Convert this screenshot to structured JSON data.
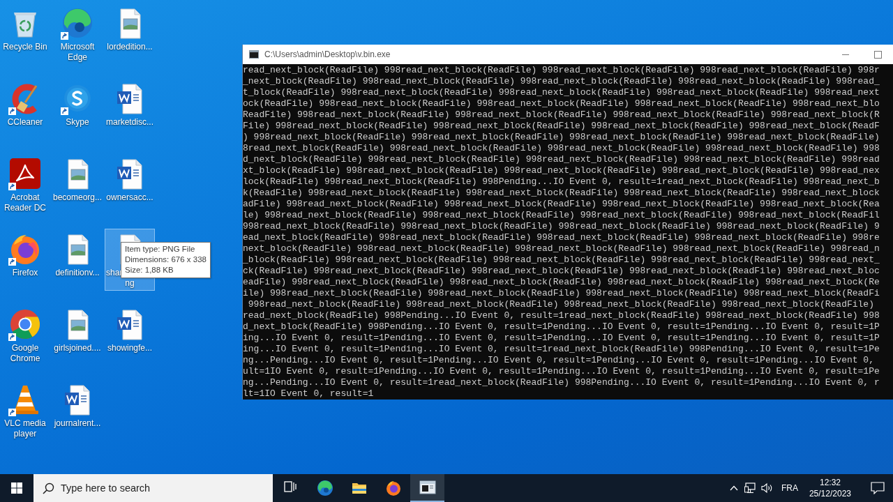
{
  "desktop_icons": [
    {
      "lines": [
        "Recycle Bin"
      ],
      "kind": "recycle",
      "shortcut": false,
      "selected": false
    },
    {
      "lines": [
        "Microsoft",
        "Edge"
      ],
      "kind": "edge",
      "shortcut": true,
      "selected": false
    },
    {
      "lines": [
        "lordedition..."
      ],
      "kind": "image",
      "shortcut": false,
      "selected": false
    },
    {
      "lines": [
        "CCleaner"
      ],
      "kind": "ccleaner",
      "shortcut": true,
      "selected": false
    },
    {
      "lines": [
        "Skype"
      ],
      "kind": "skype",
      "shortcut": true,
      "selected": false
    },
    {
      "lines": [
        "marketdisc..."
      ],
      "kind": "word",
      "shortcut": false,
      "selected": false
    },
    {
      "lines": [
        "Acrobat",
        "Reader DC"
      ],
      "kind": "acrobat",
      "shortcut": true,
      "selected": false
    },
    {
      "lines": [
        "becomeorg..."
      ],
      "kind": "image",
      "shortcut": false,
      "selected": false
    },
    {
      "lines": [
        "ownersacc..."
      ],
      "kind": "word",
      "shortcut": false,
      "selected": false
    },
    {
      "lines": [
        "Firefox"
      ],
      "kind": "firefox",
      "shortcut": true,
      "selected": false
    },
    {
      "lines": [
        "definitionv..."
      ],
      "kind": "image",
      "shortcut": false,
      "selected": false
    },
    {
      "lines": [
        "shar",
        "ng"
      ],
      "kind": "image",
      "shortcut": false,
      "selected": true
    },
    {
      "lines": [
        "Google",
        "Chrome"
      ],
      "kind": "chrome",
      "shortcut": true,
      "selected": false
    },
    {
      "lines": [
        "girlsjoined...."
      ],
      "kind": "image",
      "shortcut": false,
      "selected": false
    },
    {
      "lines": [
        "showingfe..."
      ],
      "kind": "word",
      "shortcut": false,
      "selected": false
    },
    {
      "lines": [
        "VLC media",
        "player"
      ],
      "kind": "vlc",
      "shortcut": true,
      "selected": false
    },
    {
      "lines": [
        "journalrent..."
      ],
      "kind": "word",
      "shortcut": false,
      "selected": false
    }
  ],
  "tooltip": {
    "lines": [
      "Item type: PNG File",
      "Dimensions: 676 x 338",
      "Size: 1,88 KB"
    ]
  },
  "console_window": {
    "title": "C:\\Users\\admin\\Desktop\\v.bin.exe",
    "lines": [
      "read_next_block(ReadFile) 998read_next_block(ReadFile) 998read_next_block(ReadFile) 998read_next_block(ReadFile) 998r",
      "_next_block(ReadFile) 998read_next_block(ReadFile) 998read_next_block(ReadFile) 998read_next_block(ReadFile) 998read_",
      "t_block(ReadFile) 998read_next_block(ReadFile) 998read_next_block(ReadFile) 998read_next_block(ReadFile) 998read_next",
      "ock(ReadFile) 998read_next_block(ReadFile) 998read_next_block(ReadFile) 998read_next_block(ReadFile) 998read_next_blo",
      "ReadFile) 998read_next_block(ReadFile) 998read_next_block(ReadFile) 998read_next_block(ReadFile) 998read_next_block(R",
      "File) 998read_next_block(ReadFile) 998read_next_block(ReadFile) 998read_next_block(ReadFile) 998read_next_block(ReadF",
      ") 998read_next_block(ReadFile) 998read_next_block(ReadFile) 998read_next_block(ReadFile) 998read_next_block(ReadFile)",
      "8read_next_block(ReadFile) 998read_next_block(ReadFile) 998read_next_block(ReadFile) 998read_next_block(ReadFile) 998",
      "d_next_block(ReadFile) 998read_next_block(ReadFile) 998read_next_block(ReadFile) 998read_next_block(ReadFile) 998read",
      "xt_block(ReadFile) 998read_next_block(ReadFile) 998read_next_block(ReadFile) 998read_next_block(ReadFile) 998read_nex",
      "lock(ReadFile) 998read_next_block(ReadFile) 998Pending...IO Event 0, result=1read_next_block(ReadFile) 998read_next_b",
      "k(ReadFile) 998read_next_block(ReadFile) 998read_next_block(ReadFile) 998read_next_block(ReadFile) 998read_next_block",
      "adFile) 998read_next_block(ReadFile) 998read_next_block(ReadFile) 998read_next_block(ReadFile) 998read_next_block(Rea",
      "le) 998read_next_block(ReadFile) 998read_next_block(ReadFile) 998read_next_block(ReadFile) 998read_next_block(ReadFil",
      "998read_next_block(ReadFile) 998read_next_block(ReadFile) 998read_next_block(ReadFile) 998read_next_block(ReadFile) 9",
      "ead_next_block(ReadFile) 998read_next_block(ReadFile) 998read_next_block(ReadFile) 998read_next_block(ReadFile) 998re",
      "next_block(ReadFile) 998read_next_block(ReadFile) 998read_next_block(ReadFile) 998read_next_block(ReadFile) 998read_n",
      "_block(ReadFile) 998read_next_block(ReadFile) 998read_next_block(ReadFile) 998read_next_block(ReadFile) 998read_next_",
      "ck(ReadFile) 998read_next_block(ReadFile) 998read_next_block(ReadFile) 998read_next_block(ReadFile) 998read_next_bloc",
      "eadFile) 998read_next_block(ReadFile) 998read_next_block(ReadFile) 998read_next_block(ReadFile) 998read_next_block(Re",
      "ile) 998read_next_block(ReadFile) 998read_next_block(ReadFile) 998read_next_block(ReadFile) 998read_next_block(ReadFi",
      " 998read_next_block(ReadFile) 998read_next_block(ReadFile) 998read_next_block(ReadFile) 998read_next_block(ReadFile) ",
      "read_next_block(ReadFile) 998Pending...IO Event 0, result=1read_next_block(ReadFile) 998read_next_block(ReadFile) 998",
      "d_next_block(ReadFile) 998Pending...IO Event 0, result=1Pending...IO Event 0, result=1Pending...IO Event 0, result=1P",
      "ing...IO Event 0, result=1Pending...IO Event 0, result=1Pending...IO Event 0, result=1Pending...IO Event 0, result=1P",
      "ing...IO Event 0, result=1Pending...IO Event 0, result=1read_next_block(ReadFile) 998Pending...IO Event 0, result=1Pe",
      "ng...Pending...IO Event 0, result=1Pending...IO Event 0, result=1Pending...IO Event 0, result=1Pending...IO Event 0, ",
      "ult=1IO Event 0, result=1Pending...IO Event 0, result=1Pending...IO Event 0, result=1Pending...IO Event 0, result=1Pe",
      "ng...Pending...IO Event 0, result=1read_next_block(ReadFile) 998Pending...IO Event 0, result=1Pending...IO Event 0, r",
      "lt=1IO Event 0, result=1"
    ]
  },
  "taskbar": {
    "search_placeholder": "Type here to search",
    "apps": [
      {
        "kind": "taskview",
        "active": false
      },
      {
        "kind": "edge",
        "active": false
      },
      {
        "kind": "folder",
        "active": false
      },
      {
        "kind": "firefox",
        "active": false
      },
      {
        "kind": "console",
        "active": true
      }
    ],
    "tray": {
      "language": "FRA",
      "time": "12:32",
      "date": "25/12/2023"
    }
  }
}
